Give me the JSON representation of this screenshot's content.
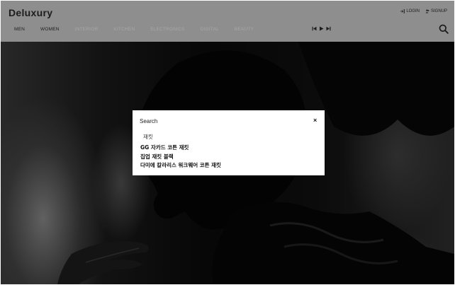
{
  "header": {
    "logo": "Deluxury",
    "login_label": "LOGIN",
    "signup_label": "SIGNUP"
  },
  "nav": {
    "items": [
      {
        "label": "MEN",
        "state": "active"
      },
      {
        "label": "WOMEN",
        "state": "active"
      },
      {
        "label": "INTERIOR",
        "state": "muted"
      },
      {
        "label": "KITCHEN",
        "state": "muted"
      },
      {
        "label": "ELECTRONICS",
        "state": "muted"
      },
      {
        "label": "DIGITAL",
        "state": "muted"
      },
      {
        "label": "BEAUTY",
        "state": "muted"
      }
    ]
  },
  "player": {
    "icons": [
      "skip-back-icon",
      "play-icon",
      "skip-forward-icon"
    ]
  },
  "search_modal": {
    "title": "Search",
    "close_label": "×",
    "query": "재킷",
    "suggestions": [
      "GG 자카드 코튼 재킷",
      "집업 재킷 블랙",
      "다미에 칼라리스 워크웨어 코튼 재킷"
    ]
  },
  "colors": {
    "header_bg": "#8e8e8e",
    "muted_nav": "#a7a7a7",
    "modal_bg": "#ffffff",
    "overlay": "rgba(0,0,0,0.55)"
  }
}
